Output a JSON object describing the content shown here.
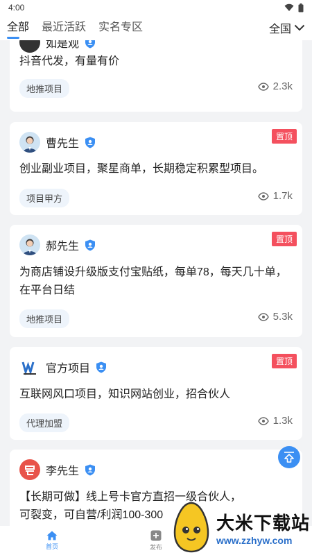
{
  "status": {
    "time": "4:00"
  },
  "tabs": [
    {
      "label": "全部"
    },
    {
      "label": "最近活跃"
    },
    {
      "label": "实名专区"
    }
  ],
  "region": {
    "label": "全国"
  },
  "cards": [
    {
      "name": "如是观",
      "content": "抖音代发，有量有价",
      "category": "地推项目",
      "views": "2.3k"
    },
    {
      "name": "曹先生",
      "top_label": "置顶",
      "content": "创业副业项目，聚星商单，长期稳定积累型项目。",
      "category": "项目甲方",
      "views": "1.7k"
    },
    {
      "name": "郝先生",
      "top_label": "置顶",
      "content": "为商店铺设升级版支付宝贴纸，每单78，每天几十单，在平台日结",
      "category": "地推项目",
      "views": "5.3k"
    },
    {
      "name": "官方项目",
      "top_label": "置顶",
      "content": "互联网风口项目，知识网站创业，招合伙人",
      "category": "代理加盟",
      "views": "1.3k"
    },
    {
      "name": "李先生",
      "content": "【长期可做】线上号卡官方直招一级合伙人，可裂变，可自营/利润100-300"
    }
  ],
  "bottom_nav": [
    {
      "label": "首页"
    },
    {
      "label": "发布"
    }
  ],
  "watermark": {
    "title": "大米下载站",
    "url": "www.zzhyw.com"
  },
  "colors": {
    "accent": "#3b8ff3",
    "top_tag": "#f4505e"
  }
}
